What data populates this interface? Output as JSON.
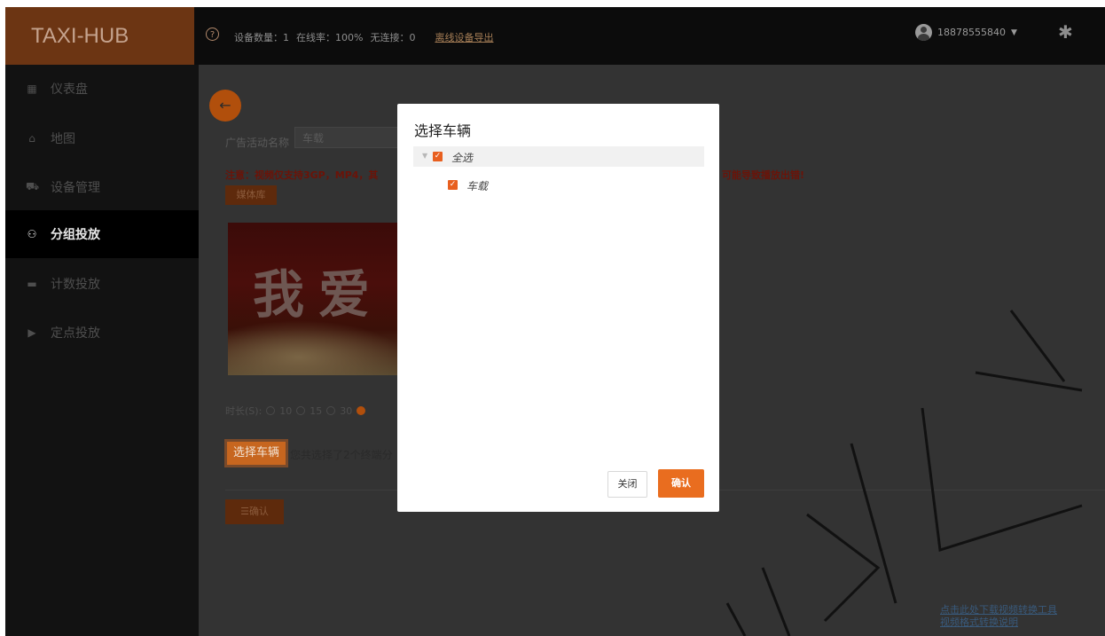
{
  "app": {
    "logo": "TAXI-HUB",
    "status": {
      "device_count": "设备数量：1",
      "online_rate": "在线率：100%",
      "no_connection": "无连接：0",
      "export_link": "离线设备导出"
    },
    "user": {
      "phone": "18878555840"
    }
  },
  "sidebar": {
    "items": [
      {
        "label": "仪表盘",
        "icon": "dashboard-icon"
      },
      {
        "label": "地图",
        "icon": "map-icon"
      },
      {
        "label": "设备管理",
        "icon": "car-icon"
      },
      {
        "label": "分组投放",
        "icon": "group-icon"
      },
      {
        "label": "计数投放",
        "icon": "count-icon"
      },
      {
        "label": "定点投放",
        "icon": "play-icon"
      }
    ]
  },
  "main": {
    "campaign_label": "广告活动名称",
    "campaign_value": "车载",
    "notice": "注意：视频仅支持3GP，MP4，其",
    "notice_end": "可能导致播放出错!",
    "media_button": "媒体库",
    "preview_text": "我爱",
    "duration": {
      "label": "时长(S):",
      "options": [
        "10",
        "15",
        "30"
      ],
      "selected": "30"
    },
    "select_vehicle_button": "选择车辆",
    "selected_info": "您共选择了2个终端分",
    "confirm_button": "确认",
    "download_links": [
      "点击此处下载视频转换工具",
      "视频格式转换说明"
    ]
  },
  "modal": {
    "title": "选择车辆",
    "tree": {
      "root_label": "全选",
      "child_label": "车载"
    },
    "close_button": "关闭",
    "confirm_button": "确认"
  },
  "colors": {
    "accent": "#e96d1f",
    "logo_bg": "#6c3513",
    "sidebar_bg": "#121212",
    "notice": "#6b1308"
  }
}
